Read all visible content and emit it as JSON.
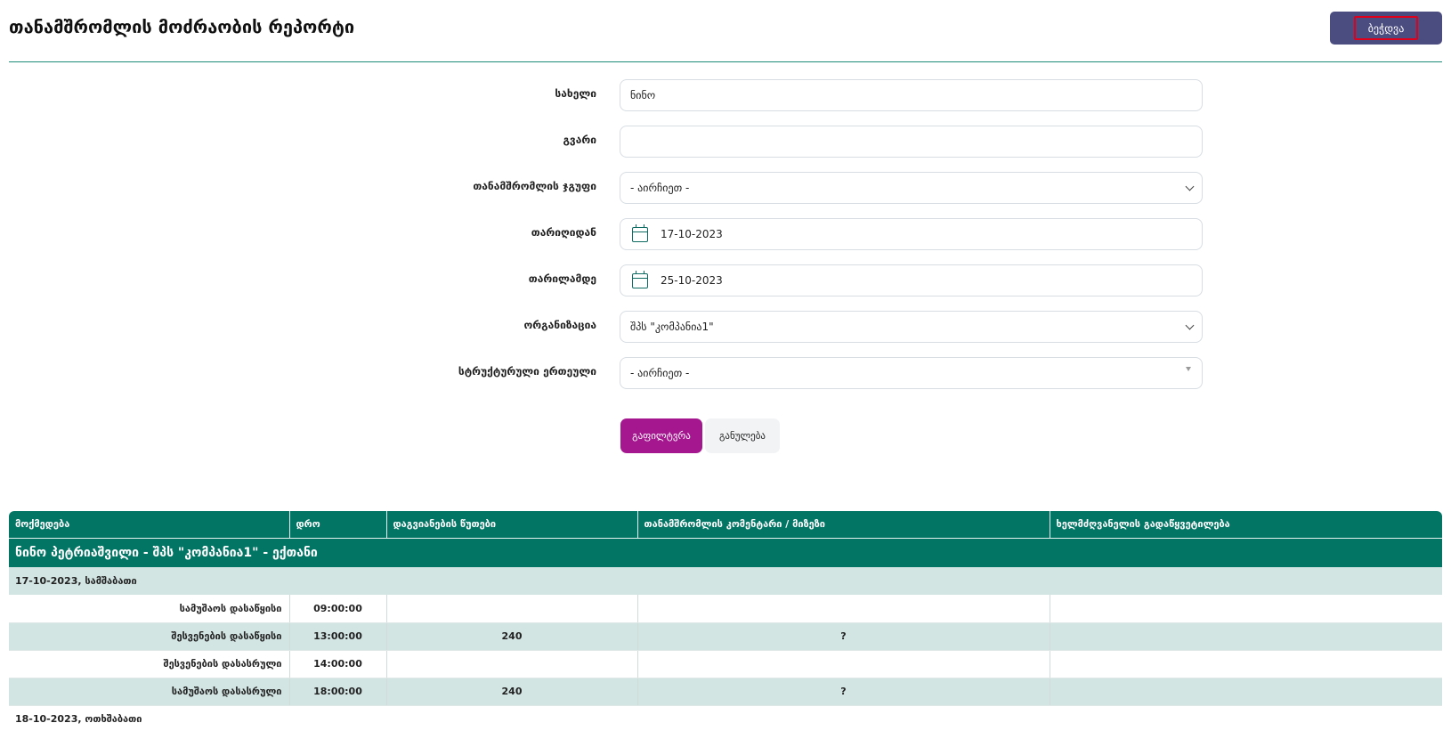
{
  "header": {
    "title": "თანამშრომლის მოძრაობის რეპორტი",
    "print_label": "ბეჭდვა"
  },
  "form": {
    "first_name": {
      "label": "სახელი",
      "value": "ნინო"
    },
    "last_name": {
      "label": "გვარი",
      "value": ""
    },
    "employee_group": {
      "label": "თანამშრომლის ჯგუფი",
      "value": "- აირჩიეთ -"
    },
    "date_from": {
      "label": "თარიღიდან",
      "value": "17-10-2023"
    },
    "date_to": {
      "label": "თარილამდე",
      "value": "25-10-2023"
    },
    "organization": {
      "label": "ორგანიზაცია",
      "value": "შპს \"კომპანია1\""
    },
    "structural_unit": {
      "label": "სტრუქტურული ერთეული",
      "value": "- აირჩიეთ -"
    },
    "filter_label": "გაფილტვრა",
    "reset_label": "განულება"
  },
  "table": {
    "columns": [
      "მოქმედება",
      "დრო",
      "დაგვიანების წუთები",
      "თანამშრომლის კომენტარი / მიზეზი",
      "ხელმძღვანელის გადაწყვეტილება"
    ],
    "group_title": "ნინო პეტრიაშვილი - შპს \"კომპანია1\" - ექთანი",
    "days": [
      {
        "date": "17-10-2023, სამშაბათი",
        "rows": [
          {
            "action": "სამუშაოს დასაწყისი",
            "time": "09:00:00",
            "late": "",
            "comment": "",
            "decision": ""
          },
          {
            "action": "შესვენების დასაწყისი",
            "time": "13:00:00",
            "late": "240",
            "comment": "?",
            "decision": ""
          },
          {
            "action": "შესვენების დასასრული",
            "time": "14:00:00",
            "late": "",
            "comment": "",
            "decision": ""
          },
          {
            "action": "სამუშაოს დასასრული",
            "time": "18:00:00",
            "late": "240",
            "comment": "?",
            "decision": ""
          }
        ]
      },
      {
        "date": "18-10-2023, ოთხშაბათი",
        "rows": []
      }
    ]
  }
}
